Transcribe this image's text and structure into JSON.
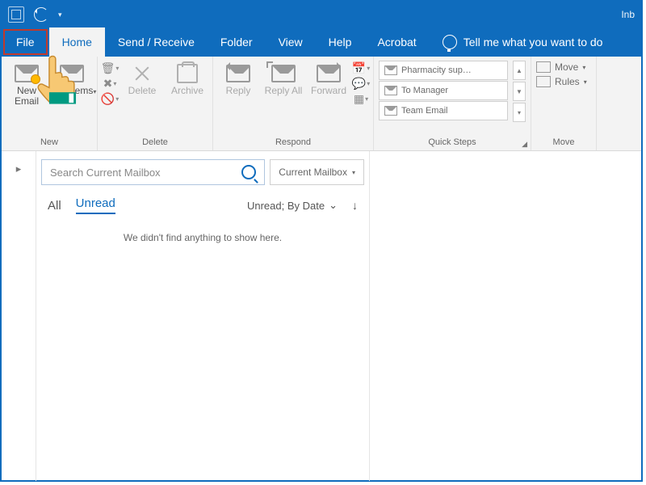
{
  "titlebar": {
    "title": "Inb"
  },
  "tabs": {
    "file": "File",
    "home": "Home",
    "sendreceive": "Send / Receive",
    "folder": "Folder",
    "view": "View",
    "help": "Help",
    "acrobat": "Acrobat",
    "tell": "Tell me what you want to do"
  },
  "ribbon": {
    "new": {
      "label": "New",
      "email": "New Email",
      "items": "New Items"
    },
    "delete": {
      "label": "Delete",
      "delete": "Delete",
      "archive": "Archive"
    },
    "respond": {
      "label": "Respond",
      "reply": "Reply",
      "replyall": "Reply All",
      "forward": "Forward"
    },
    "quicksteps": {
      "label": "Quick Steps",
      "items": [
        "Pharmacity sup…",
        "To Manager",
        "Team Email"
      ]
    },
    "move": {
      "label": "Move",
      "move": "Move",
      "rules": "Rules"
    }
  },
  "search": {
    "placeholder": "Search Current Mailbox",
    "scope": "Current Mailbox"
  },
  "filters": {
    "all": "All",
    "unread": "Unread",
    "sort": "Unread; By Date"
  },
  "empty": "We didn't find anything to show here."
}
